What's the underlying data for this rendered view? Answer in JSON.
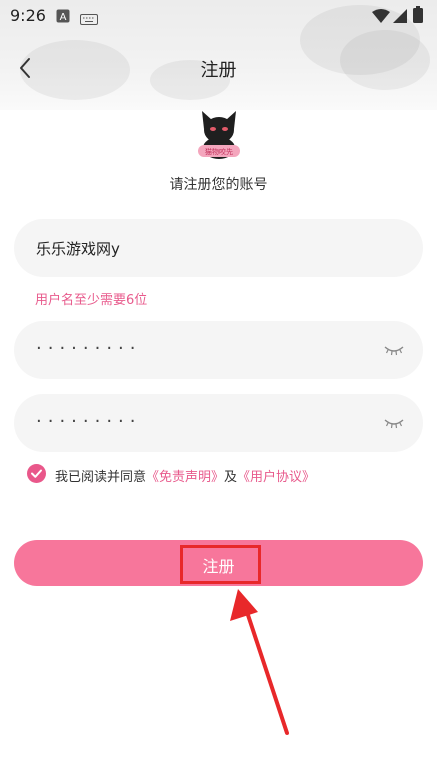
{
  "status_bar": {
    "time": "9:26"
  },
  "header": {
    "title": "注册"
  },
  "subtitle": "请注册您的账号",
  "logo": {
    "badge_text": "猫物咬先"
  },
  "form": {
    "username": {
      "value": "乐乐游戏网y"
    },
    "username_hint": "用户名至少需要6位",
    "password": {
      "masked_value": "·········"
    },
    "confirm_password": {
      "masked_value": "·········"
    }
  },
  "agreement": {
    "checked": true,
    "prefix": "我已阅读并同意",
    "disclaimer_link": "《免责声明》",
    "conjunction": "及",
    "user_agreement_link": "《用户协议》"
  },
  "register_button": {
    "label": "注册"
  },
  "colors": {
    "accent": "#f7769b",
    "link": "#e85a8c",
    "highlight": "#e8282a"
  }
}
